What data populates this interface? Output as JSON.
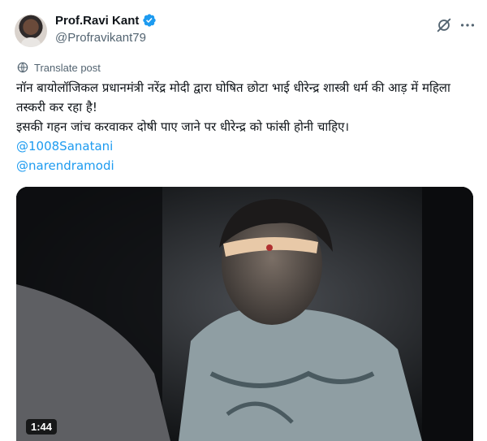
{
  "author": {
    "display_name": "Prof.Ravi Kant",
    "handle": "@Profravikant79",
    "verified": true
  },
  "actions": {
    "grok_icon": "grok-icon",
    "more_icon": "more-horizontal-icon"
  },
  "translate_label": "Translate post",
  "post": {
    "line1": "नॉन बायोलॉजिकल प्रधानमंत्री नरेंद्र मोदी द्वारा घोषित छोटा भाई धीरेन्द्र शास्त्री धर्म की आड़ में महिला तस्करी कर रहा है!",
    "line2": "इसकी गहन जांच करवाकर दोषी पाए जाने पर धीरेन्द्र को फांसी होनी चाहिए।",
    "mentions": [
      "@1008Sanatani",
      "@narendramodi"
    ]
  },
  "media": {
    "duration": "1:44"
  },
  "colors": {
    "link": "#1d9bf0",
    "secondary_text": "#536471",
    "verified_badge": "#1d9bf0"
  }
}
